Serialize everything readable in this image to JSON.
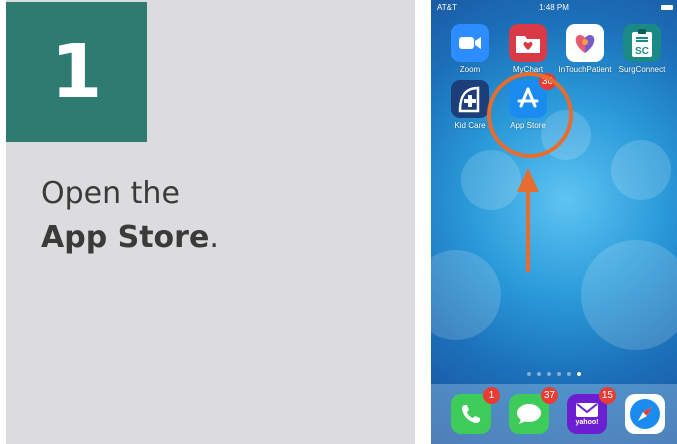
{
  "step": {
    "number": "1",
    "text_prefix": "Open the",
    "text_strong": "App Store",
    "text_suffix": "."
  },
  "status_bar": {
    "carrier": "AT&T",
    "time": "1:48 PM"
  },
  "home_screen": {
    "apps": [
      {
        "name": "Zoom",
        "icon": "video-camera-icon",
        "color": "#2d8cff"
      },
      {
        "name": "MyChart",
        "icon": "folder-heart-icon",
        "color": "#d93a46"
      },
      {
        "name": "InTouchPatient",
        "icon": "hands-heart-icon",
        "color": "#ffffff"
      },
      {
        "name": "SurgConnect",
        "icon": "clipboard-sc-icon",
        "color": "#1a8a86"
      },
      {
        "name": "Kid Care",
        "icon": "plus-shield-icon",
        "color": "#1c3f7a"
      },
      {
        "name": "App Store",
        "icon": "app-store-icon",
        "color": "#1a8cf0",
        "badge": "36"
      }
    ],
    "page_count": 6,
    "active_page": 6
  },
  "dock": {
    "apps": [
      {
        "name": "Phone",
        "icon": "phone-icon",
        "color": "#3dcc5a",
        "badge": "1"
      },
      {
        "name": "Messages",
        "icon": "message-bubble-icon",
        "color": "#3dcc5a",
        "badge": "37"
      },
      {
        "name": "Yahoo Mail",
        "icon": "yahoo-mail-icon",
        "color": "#6b1fd0",
        "badge": "15",
        "label": "yahoo!"
      },
      {
        "name": "Safari",
        "icon": "compass-icon",
        "color": "#1a8cf0"
      }
    ]
  },
  "colors": {
    "accent": "#2e7b72",
    "highlight": "#e66d2f",
    "panel": "#dcdcdf"
  }
}
